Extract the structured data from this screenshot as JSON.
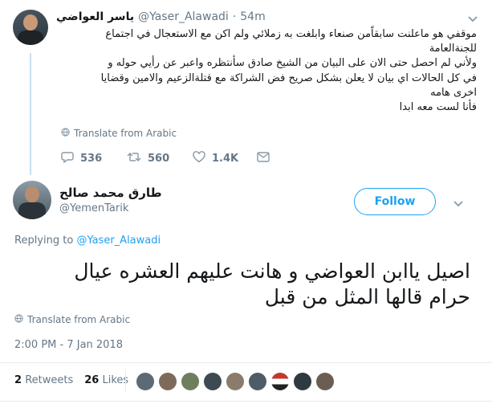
{
  "parent_tweet": {
    "display_name": "ياسر العواضي",
    "handle": "@Yaser_Alawadi",
    "separator": "·",
    "time": "54m",
    "lines": [
      "موقفي هو ماعلنت سابقاًمن صنعاء وابلغت به زملائي ولم اكن مع الاستعجال في اجتماع",
      "للجنةالعامة",
      "ولأني لم احصل حتى الان على البيان  من الشيخ صادق سأنتظره واعبر عن رأيي حوله و",
      "في كل الحالات اي بيان لا يعلن بشكل صريح فض الشراكة مع قتلةالزعيم والامين وقضايا",
      "اخرى هامه",
      "فأنا لست معه ابدا"
    ],
    "translate_label": "Translate from Arabic",
    "replies": "536",
    "retweets": "560",
    "likes": "1.4K"
  },
  "main_tweet": {
    "display_name": "طارق محمد صالح",
    "handle": "@YemenTarik",
    "follow_label": "Follow",
    "replying_to_label": "Replying to",
    "replying_to_handle": "@Yaser_Alawadi",
    "text_line1": "اصيل  ياابن العواضي و هانت عليهم العشره عيال",
    "text_line2": "حرام قالها المثل من قبل",
    "translate_label": "Translate from Arabic",
    "timestamp": "2:00 PM - 7 Jan 2018",
    "retweets_count": "2",
    "retweets_label": "Retweets",
    "likes_count": "26",
    "likes_label": "Likes"
  },
  "colors": {
    "accent": "#1da1f2",
    "muted": "#657786",
    "divider": "#e6ecf0"
  },
  "icons": [
    "globe-icon",
    "reply-icon",
    "retweet-icon",
    "heart-icon",
    "envelope-icon",
    "chevron-down-icon"
  ]
}
